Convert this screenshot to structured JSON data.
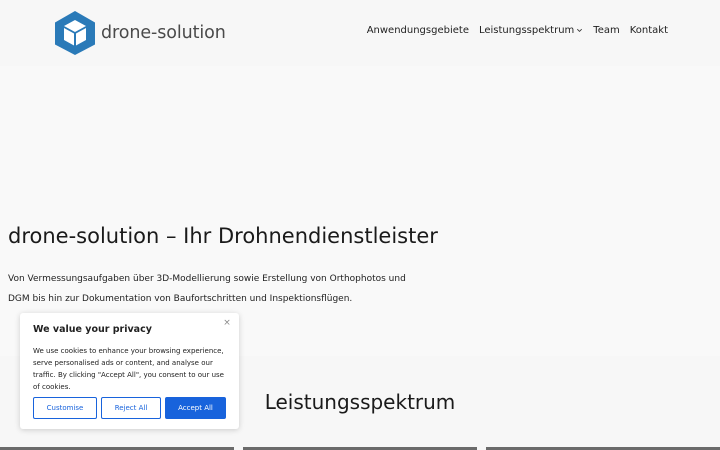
{
  "header": {
    "logo_text": "drone-solution",
    "nav": [
      {
        "label": "Anwendungsgebiete"
      },
      {
        "label": "Leistungsspektrum"
      },
      {
        "label": "Team"
      },
      {
        "label": "Kontakt"
      }
    ]
  },
  "hero": {
    "title": "drone-solution – Ihr Drohnendienstleister",
    "text": "Von Vermessungsaufgaben über 3D-Modellierung sowie Erstellung von Orthophotos und DGM bis hin zur Dokumentation von Baufortschritten und Inspektionsflügen."
  },
  "services": {
    "title": "Leistungsspektrum"
  },
  "cookie": {
    "title": "We value your privacy",
    "close": "×",
    "text": "We use cookies to enhance your browsing experience, serve personalised ads or content, and analyse our traffic. By clicking \"Accept All\", you consent to our use of cookies.",
    "customise_label": "Customise",
    "reject_label": "Reject All",
    "accept_label": "Accept All"
  },
  "colors": {
    "brand": "#2a7ab8",
    "accent_button": "#1863dc"
  }
}
